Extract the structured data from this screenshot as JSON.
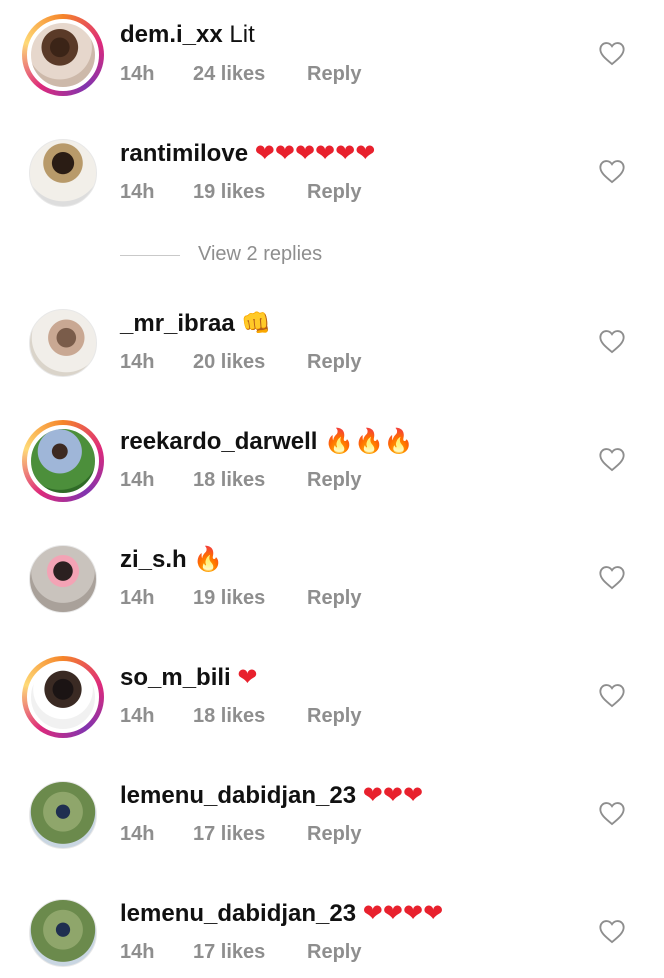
{
  "comments": [
    {
      "username": "dem.i_xx",
      "text": "Lit",
      "emoji": "",
      "time": "14h",
      "likes": "24 likes",
      "reply": "Reply",
      "avatar_ring": true
    },
    {
      "username": "rantimilove",
      "text": "",
      "emoji": "❤❤❤❤❤❤",
      "time": "14h",
      "likes": "19 likes",
      "reply": "Reply",
      "avatar_ring": false
    },
    {
      "username": "_mr_ibraa",
      "text": "",
      "emoji": "👊",
      "time": "14h",
      "likes": "20 likes",
      "reply": "Reply",
      "avatar_ring": false
    },
    {
      "username": "reekardo_darwell",
      "text": "",
      "emoji": "🔥🔥🔥",
      "time": "14h",
      "likes": "18 likes",
      "reply": "Reply",
      "avatar_ring": true
    },
    {
      "username": "zi_s.h",
      "text": "",
      "emoji": "🔥",
      "time": "14h",
      "likes": "19 likes",
      "reply": "Reply",
      "avatar_ring": false
    },
    {
      "username": "so_m_bili",
      "text": "",
      "emoji": "❤",
      "time": "14h",
      "likes": "18 likes",
      "reply": "Reply",
      "avatar_ring": true
    },
    {
      "username": "lemenu_dabidjan_23",
      "text": "",
      "emoji": "❤❤❤",
      "time": "14h",
      "likes": "17 likes",
      "reply": "Reply",
      "avatar_ring": false
    },
    {
      "username": "lemenu_dabidjan_23",
      "text": "",
      "emoji": "❤❤❤❤",
      "time": "14h",
      "likes": "17 likes",
      "reply": "Reply",
      "avatar_ring": false
    }
  ],
  "view_replies_label": "View 2 replies",
  "icons": {
    "like": "heart-outline-icon"
  },
  "colors": {
    "meta_text": "#8e8e8e",
    "heart_emoji": "#e8212d",
    "username": "#111111"
  }
}
